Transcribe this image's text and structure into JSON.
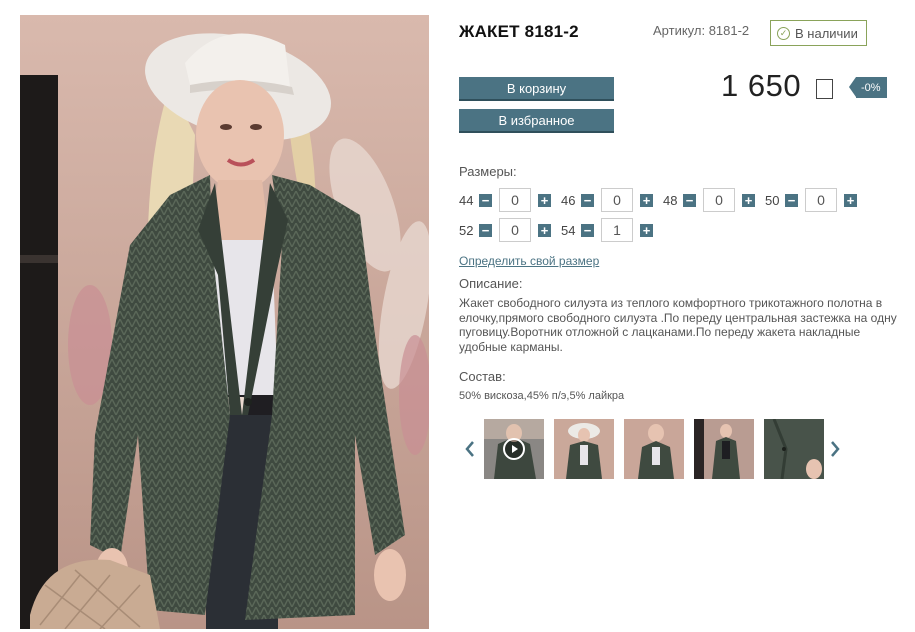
{
  "product": {
    "title": "ЖАКЕТ 8181-2",
    "article": "Артикул: 8181-2",
    "stock": "В наличии"
  },
  "actions": {
    "cart_label": "В корзину",
    "favorite_label": "В избранное"
  },
  "price": {
    "value": "1 650",
    "discount": "-0%"
  },
  "sizes": {
    "label": "Размеры:",
    "items": [
      {
        "size": "44",
        "qty": "0"
      },
      {
        "size": "46",
        "qty": "0"
      },
      {
        "size": "48",
        "qty": "0"
      },
      {
        "size": "50",
        "qty": "0"
      },
      {
        "size": "52",
        "qty": "0"
      },
      {
        "size": "54",
        "qty": "1"
      }
    ],
    "minus": "−",
    "plus": "+",
    "size_link": "Определить свой размер"
  },
  "description": {
    "label": "Описание:",
    "text": "Жакет свободного силуэта из теплого комфортного трикотажного полотна в елочку,прямого свободного силуэта .По переду центральная застежка на одну пуговицу.Воротник отложной с лацканами.По переду жакета накладные удобные карманы."
  },
  "composition": {
    "label": "Состав:",
    "text": "50% вискоза,45% п/э,5% лайкра"
  },
  "gallery": {
    "icons": [
      "chevron-left-icon",
      "play-icon",
      "chevron-right-icon"
    ],
    "accent": "#4b7383"
  },
  "colors": {
    "accent": "#4b7383",
    "stock_border": "#8aa35a"
  }
}
